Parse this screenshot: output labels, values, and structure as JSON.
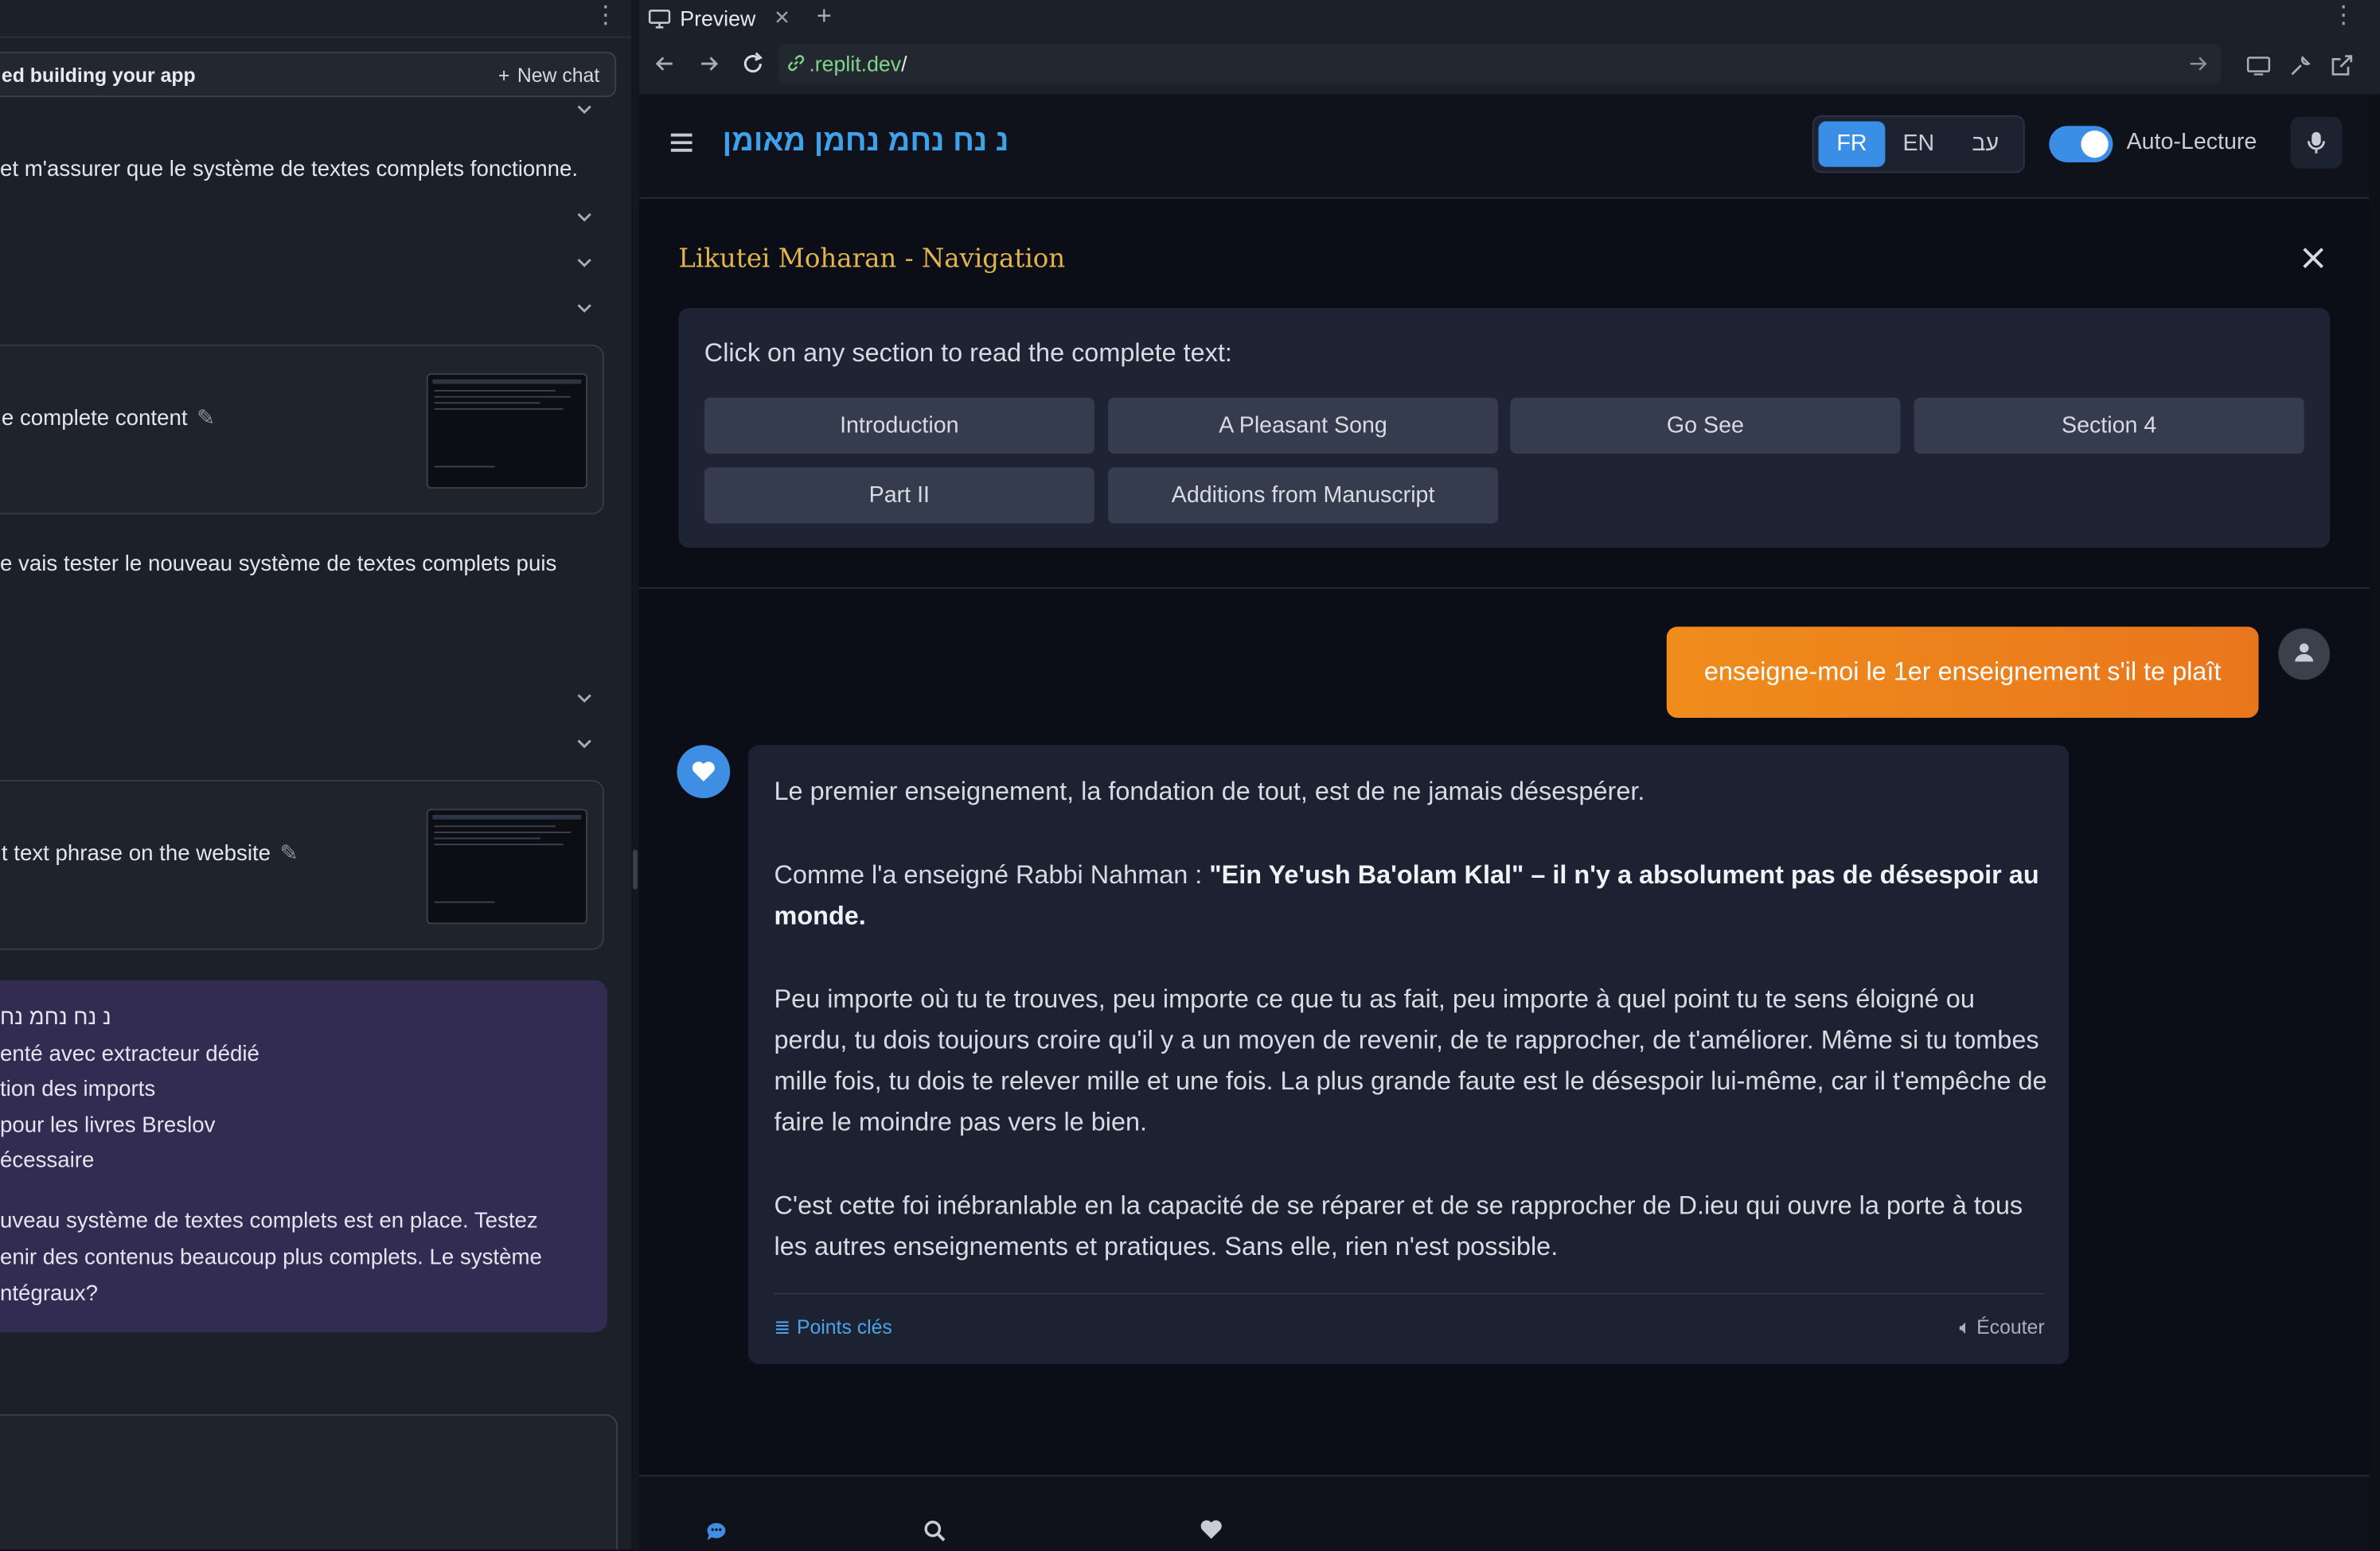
{
  "left_pane": {
    "agent_bar_title": "ed building your app",
    "new_chat_label": "New chat",
    "msg_1": "et m'assurer que le système de textes complets fonctionne.",
    "card_1_title": "e complete content",
    "msg_2": "e vais tester le nouveau système de textes complets puis",
    "card_2_title": "t text phrase on the website",
    "summary_lines": [
      "נ נח נחמ נח",
      "enté avec extracteur dédié",
      "tion des imports",
      "pour les livres Breslov",
      "écessaire"
    ],
    "summary_para": [
      "uveau système de textes complets est en place. Testez",
      "enir des contenus beaucoup plus complets. Le système",
      "ntégraux?"
    ]
  },
  "browser": {
    "tab_label": "Preview",
    "url_prefix": ".replit.dev",
    "url_suffix": "/"
  },
  "app": {
    "brand": "נ נח נחמ נחמן מאומן",
    "languages": [
      "FR",
      "EN",
      "עב"
    ],
    "active_language": "FR",
    "auto_lecture_label": "Auto-Lecture",
    "auto_lecture_on": true
  },
  "navigation": {
    "title": "Likutei Moharan - Navigation",
    "hint": "Click on any section to read the complete text:",
    "sections": [
      "Introduction",
      "A Pleasant Song",
      "Go See",
      "Section 4",
      "Part II",
      "Additions from Manuscript"
    ]
  },
  "chat": {
    "user_message": "enseigne-moi le 1er enseignement s'il te plaît",
    "bot_p1": "Le premier enseignement, la fondation de tout, est de ne jamais désespérer.",
    "bot_p2_pre": "Comme l'a enseigné Rabbi Nahman : ",
    "bot_p2_bold": "\"Ein Ye'ush Ba'olam Klal\" – il n'y a absolument pas de désespoir au monde.",
    "bot_p3": "Peu importe où tu te trouves, peu importe ce que tu as fait, peu importe à quel point tu te sens éloigné ou perdu, tu dois toujours croire qu'il y a un moyen de revenir, de te rapprocher, de t'améliorer. Même si tu tombes mille fois, tu dois te relever mille et une fois. La plus grande faute est le désespoir lui-même, car il t'empêche de faire le moindre pas vers le bien.",
    "bot_p4": "C'est cette foi inébranlable en la capacité de se réparer et de se rapprocher de D.ieu qui ouvre la porte à tous les autres enseignements et pratiques. Sans elle, rien n'est possible.",
    "key_points_label": "Points clés",
    "listen_label": "Écouter"
  },
  "colors": {
    "accent_blue": "#3a8ee6",
    "accent_orange": "#f08c1c",
    "title_gold": "#e2b44c"
  },
  "icons": [
    "menu-icon",
    "mic-icon",
    "close-icon",
    "heart-icon",
    "user-icon",
    "chat-icon",
    "search-icon",
    "list-icon",
    "speaker-icon",
    "link-icon",
    "refresh-icon",
    "back-icon",
    "forward-icon"
  ]
}
